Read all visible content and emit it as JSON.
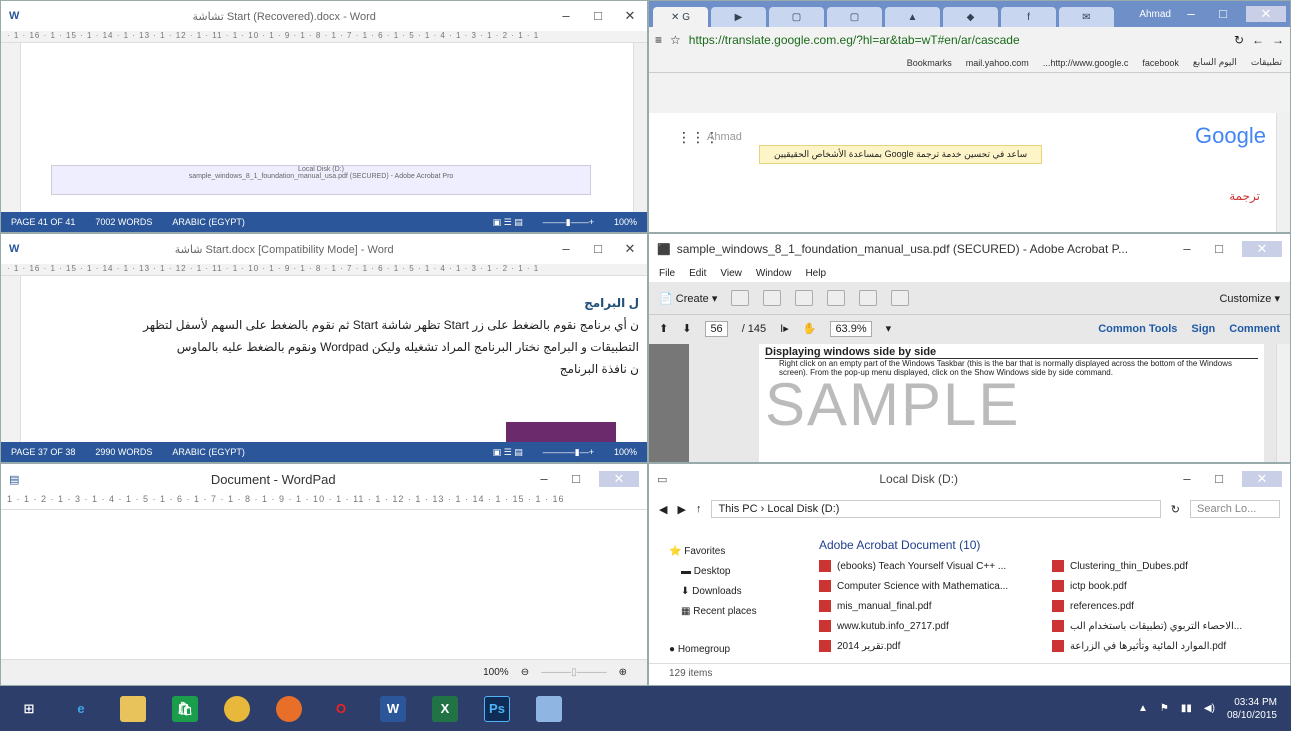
{
  "word1": {
    "title": "تشاشة Start (Recovered).docx - Word",
    "status": {
      "page": "PAGE 41 OF 41",
      "words": "7002 WORDS",
      "lang": "ARABIC (EGYPT)",
      "zoom": "100%"
    },
    "ruler": "· 1 · 16 · 1 · 15 · 1 · 14 · 1 · 13 · 1 · 12 · 1 · 11 · 1 · 10 · 1 · 9 · 1 · 8 · 1 · 7 · 1 · 6 · 1 · 5 · 1 · 4 · 1 · 3 · 1 · 2 · 1 · 1",
    "thumb_left": "Local Disk (D:)",
    "thumb_right": "sample_windows_8_1_foundation_manual_usa.pdf (SECURED) - Adobe Acrobat Pro"
  },
  "word2": {
    "title": "شاشة Start.docx [Compatibility Mode] - Word",
    "status": {
      "page": "PAGE 37 OF 38",
      "words": "2990 WORDS",
      "lang": "ARABIC (EGYPT)",
      "zoom": "100%"
    },
    "heading": "ل البرامج",
    "line1": "ن أي برنامج نقوم بالضغط على زر Start تظهر شاشة Start ثم نقوم بالضغط على السهم لأسفل لتظهر",
    "line2": "التطبيقات و البرامج نختار البرنامج المراد تشغيله وليكن Wordpad ونقوم بالضغط عليه بالماوس",
    "line3": "ن نافذة البرنامج"
  },
  "wordpad": {
    "title": "Document - WordPad",
    "ruler": "1 · 1 · 2 · 1 · 3 · 1 · 4 · 1 · 5 · 1 · 6 · 1 · 7 · 1 · 8 · 1 · 9 · 1 · 10 · 1 · 11 · 1 · 12 · 1 · 13 · 1 · 14 · 1 · 15 · 1 · 16",
    "zoom": "100%"
  },
  "chrome": {
    "user": "Ahmad",
    "url": "https://translate.google.com.eg/?hl=ar&tab=wT#en/ar/cascade",
    "bookmarks": [
      "تطبيقات",
      "اليوم السابع",
      "facebook",
      "http://www.google.c...",
      "mail.yahoo.com",
      "Bookmarks"
    ],
    "account": "Ahmad",
    "logo": "Google",
    "banner": "ساعد في تحسين خدمة ترجمة Google بمساعدة الأشخاص الحقيقيين",
    "translate": "ترجمة"
  },
  "acrobat": {
    "title": "sample_windows_8_1_foundation_manual_usa.pdf (SECURED) - Adobe Acrobat P...",
    "menu": [
      "File",
      "Edit",
      "View",
      "Window",
      "Help"
    ],
    "create": "Create",
    "customize": "Customize",
    "page": "56",
    "pages": "/ 145",
    "zoom": "63.9%",
    "common_tools": "Common Tools",
    "sign": "Sign",
    "comment": "Comment",
    "doc_heading": "Displaying windows side by side",
    "doc_text": "Right click on an empty part of the Windows Taskbar (this is the bar that is normally displayed across the bottom of the Windows screen). From the pop-up menu displayed, click on the Show Windows side by side command.",
    "watermark": "SAMPLE"
  },
  "explorer": {
    "title": "Local Disk (D:)",
    "path": "This PC  ›  Local Disk (D:)",
    "search": "Search Lo...",
    "nav": [
      "Favorites",
      "Desktop",
      "Downloads",
      "Recent places",
      "Homegroup"
    ],
    "group": "Adobe Acrobat Document (10)",
    "files_left": [
      "(ebooks) Teach Yourself Visual C++ ...",
      "Computer Science with Mathematica...",
      "mis_manual_final.pdf",
      "www.kutub.info_2717.pdf",
      "2014 تقرير.pdf"
    ],
    "files_right": [
      "Clustering_thin_Dubes.pdf",
      "ictp book.pdf",
      "references.pdf",
      "الاحصاء التربوي (تطبيقات باستخدام الب...",
      "الموارد المائية وتأثيرها في الزراعة.pdf"
    ],
    "count": "129 items"
  },
  "taskbar": {
    "time": "03:34 PM",
    "date": "08/10/2015"
  }
}
